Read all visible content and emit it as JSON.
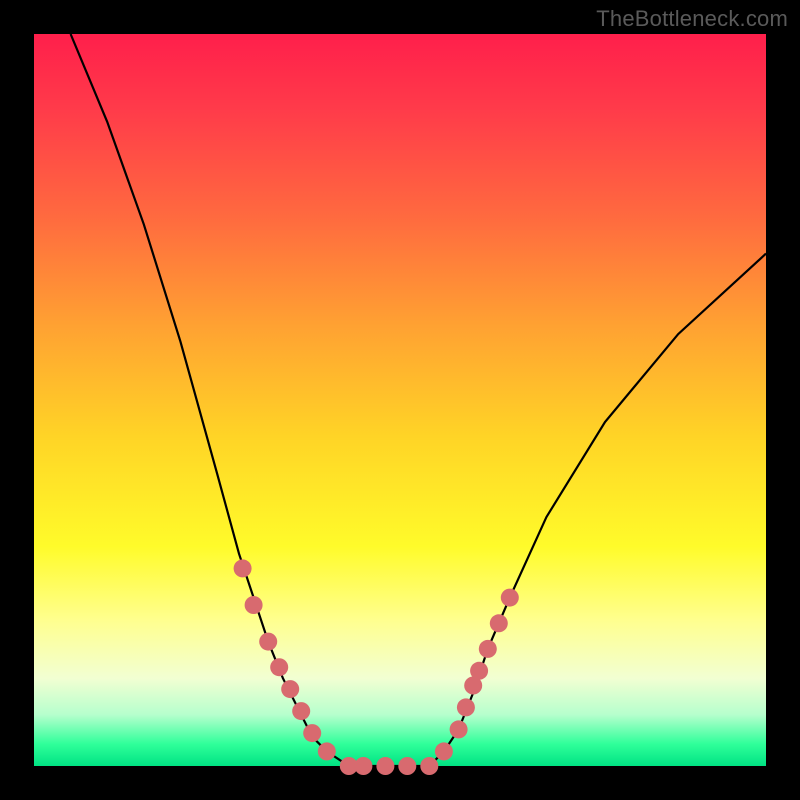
{
  "watermark": "TheBottleneck.com",
  "colors": {
    "frame": "#000000",
    "curve": "#000000",
    "dot": "#d86a6f",
    "gradient_top": "#ff1f4b",
    "gradient_bottom": "#00e383"
  },
  "chart_data": {
    "type": "line",
    "title": "",
    "xlabel": "",
    "ylabel": "",
    "xlim": [
      0,
      100
    ],
    "ylim": [
      0,
      100
    ],
    "grid": false,
    "series": [
      {
        "name": "left-curve",
        "x": [
          5,
          10,
          15,
          20,
          25,
          28,
          30,
          32,
          34,
          36,
          38,
          40,
          43,
          45
        ],
        "y": [
          100,
          88,
          74,
          58,
          40,
          29,
          23,
          17,
          12,
          8,
          4,
          2,
          0,
          0
        ]
      },
      {
        "name": "trough",
        "x": [
          45,
          48,
          51,
          54
        ],
        "y": [
          0,
          0,
          0,
          0
        ]
      },
      {
        "name": "right-curve",
        "x": [
          54,
          56,
          58,
          60,
          62,
          65,
          70,
          78,
          88,
          100
        ],
        "y": [
          0,
          2,
          5,
          10,
          16,
          23,
          34,
          47,
          59,
          70
        ]
      }
    ],
    "scatter_points": {
      "note": "pink dots lying on the curve in the lower region",
      "x": [
        28.5,
        30,
        32,
        33.5,
        35,
        36.5,
        38,
        40,
        43,
        45,
        48,
        51,
        54,
        56,
        58,
        59,
        60,
        60.8,
        62,
        63.5,
        65
      ],
      "y": [
        27,
        22,
        17,
        13.5,
        10.5,
        7.5,
        4.5,
        2,
        0,
        0,
        0,
        0,
        0,
        2,
        5,
        8,
        11,
        13,
        16,
        19.5,
        23
      ]
    }
  }
}
